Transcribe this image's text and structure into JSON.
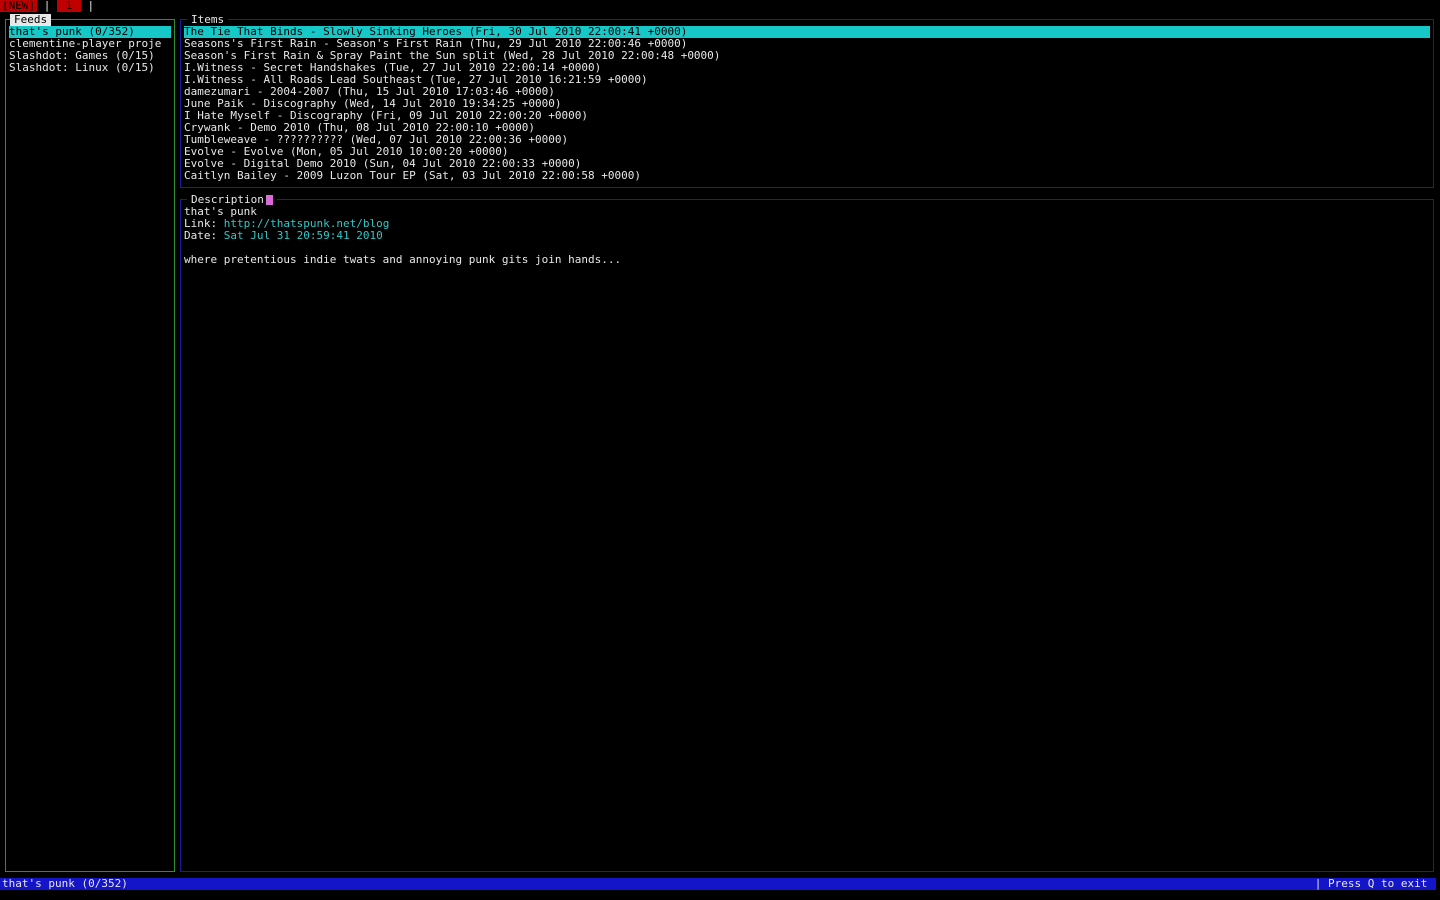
{
  "tabbar": {
    "new_tab": "[NEW]",
    "sep1": " | ",
    "tab1": " 1 ",
    "sep2": " |"
  },
  "feeds": {
    "title": "Feeds",
    "items": [
      "that's punk (0/352)",
      "clementine-player proje",
      "Slashdot: Games (0/15)",
      "Slashdot: Linux (0/15)"
    ]
  },
  "items": {
    "title": "Items",
    "entries": [
      "The Tie That Binds - Slowly Sinking Heroes (Fri, 30 Jul 2010 22:00:41 +0000)",
      "Seasons's First Rain - Season's First Rain (Thu, 29 Jul 2010 22:00:46 +0000)",
      "Season's First Rain & Spray Paint the Sun split (Wed, 28 Jul 2010 22:00:48 +0000)",
      "I.Witness - Secret Handshakes (Tue, 27 Jul 2010 22:00:14 +0000)",
      "I.Witness - All Roads Lead Southeast (Tue, 27 Jul 2010 16:21:59 +0000)",
      "damezumari - 2004-2007 (Thu, 15 Jul 2010 17:03:46 +0000)",
      "June Paik - Discography (Wed, 14 Jul 2010 19:34:25 +0000)",
      "I Hate Myself - Discography (Fri, 09 Jul 2010 22:00:20 +0000)",
      "Crywank - Demo 2010 (Thu, 08 Jul 2010 22:00:10 +0000)",
      "Tumbleweave - ?????????? (Wed, 07 Jul 2010 22:00:36 +0000)",
      "Evolve - Evolve (Mon, 05 Jul 2010 10:00:20 +0000)",
      "Evolve - Digital Demo 2010 (Sun, 04 Jul 2010 22:00:33 +0000)",
      "Caitlyn Bailey - 2009 Luzon Tour EP (Sat, 03 Jul 2010 22:00:58 +0000)"
    ]
  },
  "description": {
    "title": "Description",
    "feed_name": "that's punk",
    "link_label": "Link: ",
    "link_value": "http://thatspunk.net/blog",
    "date_label": "Date: ",
    "date_value": "Sat Jul 31 20:59:41 2010",
    "body": "where pretentious indie twats and annoying punk gits join hands..."
  },
  "statusbar": {
    "left": "that's punk (0/352)",
    "right": "| Press Q to exit "
  },
  "colors": {
    "selection": "#16c8c8",
    "status_bg": "#1414c8",
    "feeds_border": "#2f8f2f",
    "panel_border": "#1a1a9a",
    "link": "#2ec8c8",
    "tab_red": "#c00000"
  }
}
